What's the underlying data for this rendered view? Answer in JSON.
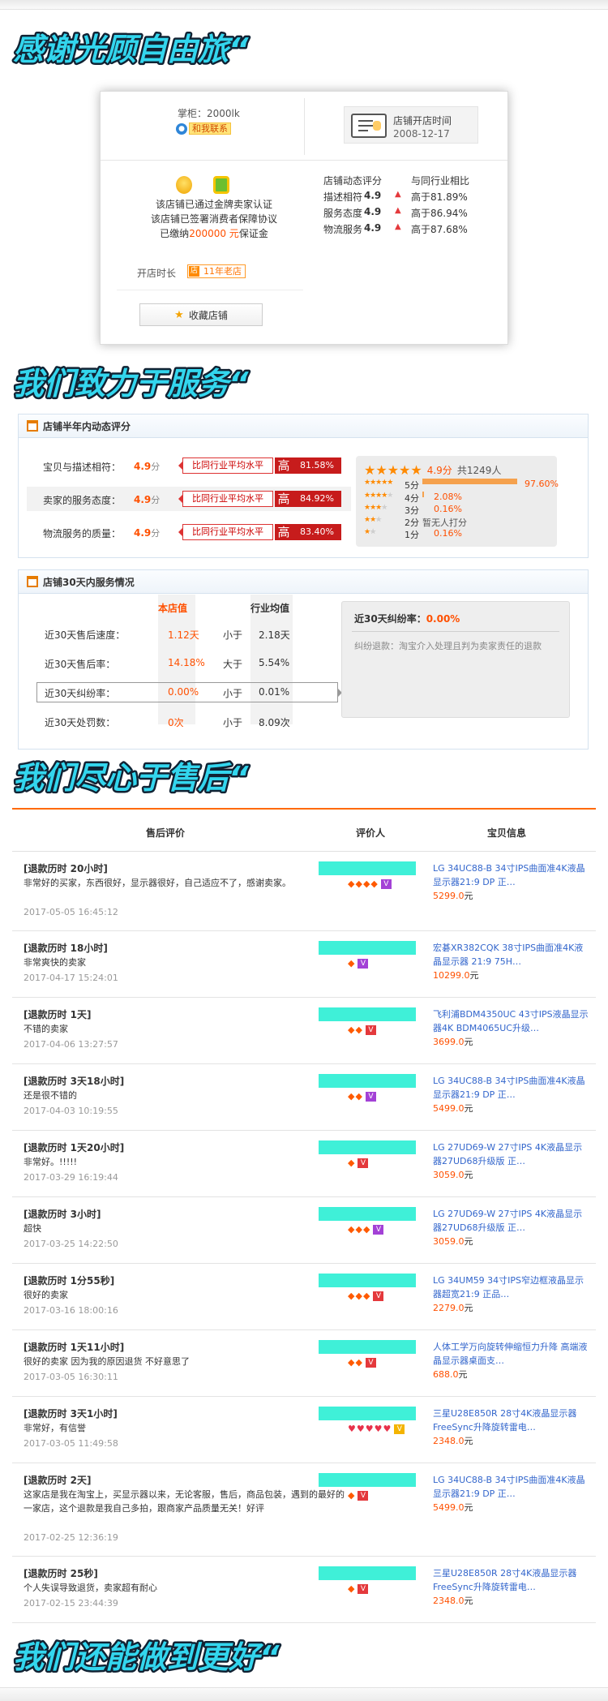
{
  "banners": [
    "感谢光顾自由旅“",
    "我们致力于服务“",
    "我们尽心于售后“",
    "我们还能做到更好“"
  ],
  "shop": {
    "owner_label": "掌柜：2000lk",
    "contact_label": "和我联系",
    "open_time_label": "店铺开店时间",
    "open_time_value": "2008-12-17",
    "cert_lines": [
      "该店铺已通过金牌卖家认证",
      "该店铺已签署消费者保障协议"
    ],
    "deposit_prefix": "已缴纳",
    "deposit_amount": "200000 元",
    "deposit_suffix": "保证金",
    "rating_header": "店铺动态评分",
    "compare_header": "与同行业相比",
    "ratings": [
      {
        "label": "描述相符",
        "score": "4.9",
        "compare": "高于81.89%"
      },
      {
        "label": "服务态度",
        "score": "4.9",
        "compare": "高于86.94%"
      },
      {
        "label": "物流服务",
        "score": "4.9",
        "compare": "高于87.68%"
      }
    ],
    "open_length_label": "开店时长",
    "open_length_tag": "11年老店",
    "favorite_label": "收藏店铺"
  },
  "half_year": {
    "title": "店铺半年内动态评分",
    "rows": [
      {
        "label": "宝贝与描述相符：",
        "score": "4.9",
        "unit": "分",
        "compare": "比同行业平均水平",
        "level": "高",
        "percent": "81.58%"
      },
      {
        "label": "卖家的服务态度：",
        "score": "4.9",
        "unit": "分",
        "compare": "比同行业平均水平",
        "level": "高",
        "percent": "84.92%"
      },
      {
        "label": "物流服务的质量：",
        "score": "4.9",
        "unit": "分",
        "compare": "比同行业平均水平",
        "level": "高",
        "percent": "83.40%"
      }
    ],
    "dist_score": "4.9分",
    "dist_count": "共1249人",
    "dist": [
      {
        "stars": 5,
        "label": "5分",
        "percent": "97.60%",
        "fraction": 0.976
      },
      {
        "stars": 4,
        "label": "4分",
        "percent": "2.08%",
        "fraction": 0.0208
      },
      {
        "stars": 3,
        "label": "3分",
        "percent": "0.16%",
        "fraction": 0.0016
      },
      {
        "stars": 2,
        "label": "2分",
        "percent": "暂无人打分",
        "fraction": 0
      },
      {
        "stars": 1,
        "label": "1分",
        "percent": "0.16%",
        "fraction": 0.0016
      }
    ]
  },
  "service30": {
    "title": "店铺30天内服务情况",
    "col_shop": "本店值",
    "col_industry": "行业均值",
    "rows": [
      {
        "label": "近30天售后速度：",
        "shop": "1.12天",
        "rel": "小于",
        "industry": "2.18天"
      },
      {
        "label": "近30天售后率：",
        "shop": "14.18%",
        "rel": "大于",
        "industry": "5.54%"
      },
      {
        "label": "近30天纠纷率：",
        "shop": "0.00%",
        "rel": "小于",
        "industry": "0.01%"
      },
      {
        "label": "近30天处罚数：",
        "shop": "0次",
        "rel": "小于",
        "industry": "8.09次"
      }
    ],
    "dispute_title": "近30天纠纷率：",
    "dispute_value": "0.00%",
    "dispute_desc": "纠纷退款：淘宝介入处理且判为卖家责任的退款"
  },
  "reviews": {
    "headers": [
      "售后评价",
      "评价人",
      "宝贝信息"
    ],
    "items": [
      {
        "dur_prefix": "[退款历时 ",
        "dur": "20小时",
        "text": "非常好的买家，东西很好，显示器很好，自己适应不了，感谢卖家。",
        "date": "2017-05-05 16:45:12",
        "gems": 4,
        "hearts": false,
        "vip": "purple",
        "item": "LG 34UC88-B 34寸IPS曲面准4K液晶显示器21:9 DP 正…",
        "price": "5299.0"
      },
      {
        "dur_prefix": "[退款历时 ",
        "dur": "18小时",
        "text": "非常爽快的卖家",
        "date": "2017-04-17 15:24:01",
        "gems": 1,
        "hearts": false,
        "vip": "purple",
        "item": "宏碁XR382CQK 38寸IPS曲面准4K液晶显示器 21:9 75H…",
        "price": "10299.0"
      },
      {
        "dur_prefix": "[退款历时 ",
        "dur": "1天",
        "text": "不错的卖家",
        "date": "2017-04-06 13:27:57",
        "gems": 2,
        "hearts": false,
        "vip": "red",
        "item": "飞利浦BDM4350UC 43寸IPS液晶显示器4K BDM4065UC升级…",
        "price": "3699.0"
      },
      {
        "dur_prefix": "[退款历时 ",
        "dur": "3天18小时",
        "text": "还是很不错的",
        "date": "2017-04-03 10:19:55",
        "gems": 2,
        "hearts": false,
        "vip": "purple",
        "item": "LG 34UC88-B 34寸IPS曲面准4K液晶显示器21:9 DP 正…",
        "price": "5499.0"
      },
      {
        "dur_prefix": "[退款历时 ",
        "dur": "1天20小时",
        "text": "非常好。!!!!!",
        "date": "2017-03-29 16:19:44",
        "gems": 1,
        "hearts": false,
        "vip": "red",
        "item": "LG 27UD69-W 27寸IPS 4K液晶显示器27UD68升级版 正…",
        "price": "3059.0"
      },
      {
        "dur_prefix": "[退款历时 ",
        "dur": "3小时",
        "text": "超快",
        "date": "2017-03-25 14:22:50",
        "gems": 3,
        "hearts": false,
        "vip": "purple",
        "item": "LG 27UD69-W 27寸IPS 4K液晶显示器27UD68升级版 正…",
        "price": "3059.0"
      },
      {
        "dur_prefix": "[退款历时 ",
        "dur": "1分55秒",
        "text": "很好的卖家",
        "date": "2017-03-16 18:00:16",
        "gems": 3,
        "hearts": false,
        "vip": "red",
        "item": "LG 34UM59 34寸IPS窄边框液晶显示器超宽21:9 正品…",
        "price": "2279.0"
      },
      {
        "dur_prefix": "[退款历时 ",
        "dur": "1天11小时",
        "text": "很好的卖家 因为我的原因退货 不好意思了",
        "date": "2017-03-05 16:30:11",
        "gems": 2,
        "hearts": false,
        "vip": "red",
        "item": "人体工学万向旋转伸缩恒力升降 高端液晶显示器桌面支…",
        "price": "688.0"
      },
      {
        "dur_prefix": "[退款历时 ",
        "dur": "3天1小时",
        "text": "非常好，有信誉",
        "date": "2017-03-05 11:49:58",
        "gems": 5,
        "hearts": true,
        "vip": "gold",
        "item": "三星U28E850R 28寸4K液晶显示器FreeSync升降旋转雷电…",
        "price": "2348.0"
      },
      {
        "dur_prefix": "[退款历时 ",
        "dur": "2天",
        "text": "这家店是我在淘宝上，买显示器以来，无论客服，售后，商品包装，遇到的最好的一家店，这个退款是我自己多拍，跟商家产品质量无关！好评",
        "date": "2017-02-25 12:36:19",
        "gems": 1,
        "hearts": false,
        "vip": "red",
        "item": "LG 34UC88-B 34寸IPS曲面准4K液晶显示器21:9 DP 正…",
        "price": "5499.0"
      },
      {
        "dur_prefix": "[退款历时 ",
        "dur": "25秒",
        "text": "个人失误导致退货，卖家超有耐心",
        "date": "2017-02-15 23:44:39",
        "gems": 1,
        "hearts": false,
        "vip": "red",
        "item": "三星U28E850R 28寸4K液晶显示器FreeSync升降旋转雷电…",
        "price": "2348.0"
      }
    ],
    "price_unit": "元"
  },
  "colors": {
    "accent": "#ff5000",
    "link": "#3366cc",
    "high": "#c71c1c",
    "user_bar": "#3ff0d8"
  }
}
